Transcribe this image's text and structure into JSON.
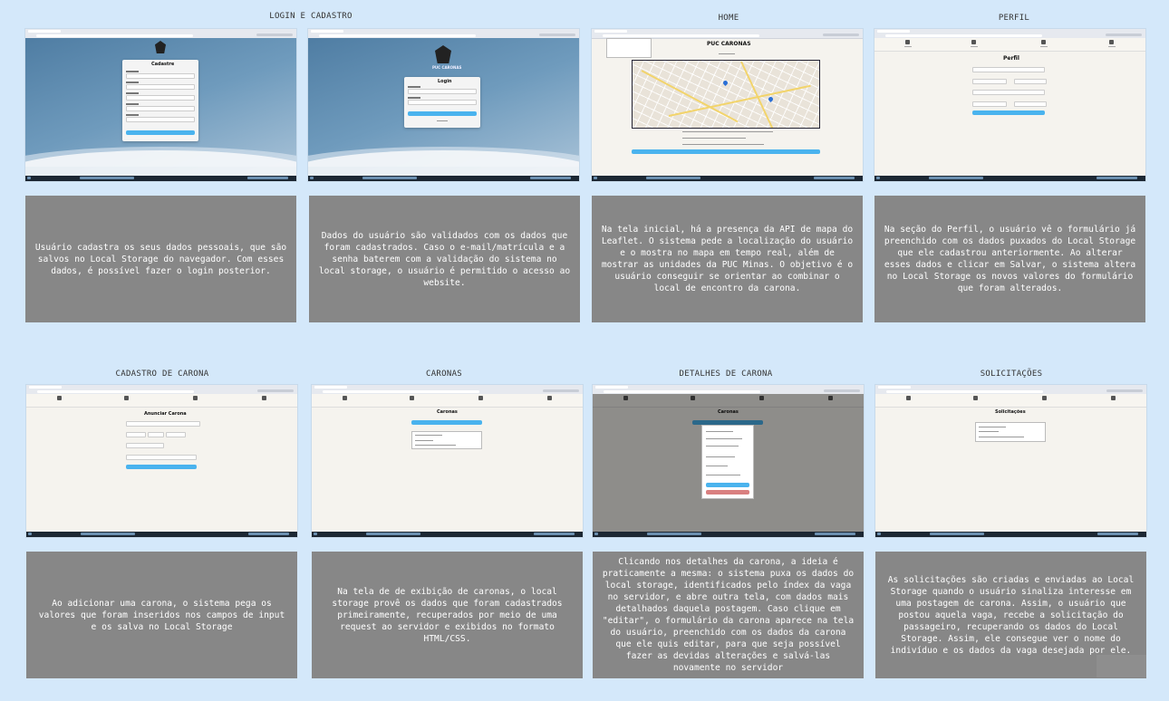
{
  "panels": [
    {
      "title": "LOGIN E CADASTRO",
      "description": "Usuário cadastra os seus dados pessoais, que são salvos no Local Storage do navegador. Com esses dados, é possível fazer o login posterior."
    },
    {
      "title": "",
      "description": "Dados do usuário são validados com os dados que foram cadastrados. Caso o e-mail/matrícula e a senha baterem com a validação do sistema no local storage, o usuário é permitido o acesso ao website."
    },
    {
      "title": "HOME",
      "description": "Na tela inicial, há a presença da API de mapa do Leaflet. O sistema pede a localização do usuário e o mostra no mapa em tempo real, além de mostrar as unidades da PUC Minas. O objetivo é o usuário conseguir se orientar ao combinar o local de encontro da carona."
    },
    {
      "title": "PERFIL",
      "description": "Na seção do Perfil, o usuário vê o formulário já preenchido com os dados puxados do Local Storage que ele cadastrou anteriormente. Ao alterar esses dados e clicar em Salvar, o sistema altera no Local Storage os novos valores do formulário que foram alterados."
    },
    {
      "title": "CADASTRO DE CARONA",
      "description": "Ao adicionar uma carona, o sistema pega os valores que foram inseridos nos campos de input e os salva no Local Storage"
    },
    {
      "title": "CARONAS",
      "description": "Na tela de de exibição de caronas, o local storage provê os dados que foram cadastrados primeiramente, recuperados por meio de uma request ao servidor e exibidos no formato HTML/CSS."
    },
    {
      "title": "DETALHES DE CARONA",
      "description": "Clicando nos detalhes da carona, a ideia é praticamente a mesma: o sistema puxa os dados do local storage, identificados pelo índex da vaga no servidor, e abre outra tela, com dados mais detalhados daquela postagem. Caso clique em \"editar\", o formulário da carona aparece na tela do usuário, preenchido com os dados da carona que ele quis editar, para que seja possível fazer as devidas alterações e salvá-las novamente no servidor"
    },
    {
      "title": "SOLICITAÇÕES",
      "description": "As solicitações são criadas e enviadas ao Local Storage quando o usuário sinaliza interesse em uma postagem de carona. Assim, o usuário que postou aquela vaga, recebe a solicitação do passageiro, recuperando os dados do Local Storage. Assim, ele consegue ver o nome do indivíduo e os dados da vaga desejada por ele."
    }
  ],
  "screens": {
    "login_a": {
      "heading": "Cadastre"
    },
    "login_b": {
      "heading": "Login",
      "brand": "PUC CARONAS"
    },
    "home": {
      "heading": "PUC CARONAS"
    },
    "perfil": {
      "heading": "Perfil"
    },
    "anunciar": {
      "heading": "Anunciar Carona"
    },
    "caronas": {
      "heading": "Caronas"
    },
    "detalhes": {
      "heading": "Caronas"
    },
    "solicitacoes": {
      "heading": "Solicitações"
    }
  }
}
